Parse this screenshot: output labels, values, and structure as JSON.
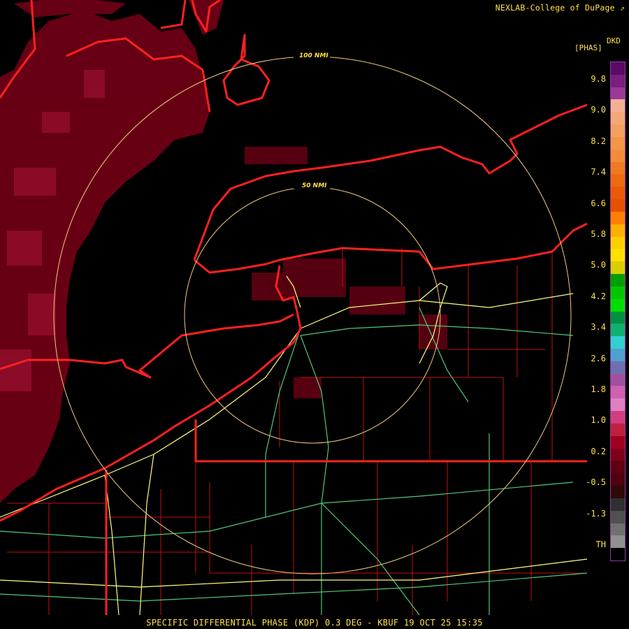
{
  "credit": "NEXLAB-College of DuPage",
  "credit_icon": "cursor-arrow-icon",
  "product_code": "DKD",
  "units": "[PHAS]",
  "footer": "SPECIFIC DIFFERENTIAL PHASE (KDP) 0.3 DEG - KBUF 19 OCT 25 15:35",
  "range_rings": {
    "inner": "50 NMI",
    "outer": "100 NMI"
  },
  "colorbar": {
    "ticks": [
      "9.8",
      "9.0",
      "8.2",
      "7.4",
      "6.6",
      "5.8",
      "5.0",
      "4.2",
      "3.4",
      "2.6",
      "1.8",
      "1.0",
      "0.2",
      "-0.5",
      "-1.3",
      "TH"
    ],
    "colors": [
      "#5a0a66",
      "#7a1e80",
      "#9a3a96",
      "#f4b096",
      "#f5a877",
      "#f4a060",
      "#f39648",
      "#f38c3a",
      "#f07a20",
      "#ee6a10",
      "#ea5a08",
      "#e85000",
      "#ff8000",
      "#ffb000",
      "#ffd000",
      "#ffe000",
      "#d8d000",
      "#00a000",
      "#00c800",
      "#00e000",
      "#009040",
      "#10b070",
      "#30d0d0",
      "#50a0d0",
      "#7070b0",
      "#a050a0",
      "#d060b0",
      "#e080c0",
      "#d04080",
      "#c02040",
      "#a00020",
      "#800018",
      "#600010",
      "#500010",
      "#300808",
      "#303030",
      "#505050",
      "#707070",
      "#909090",
      "#000000"
    ]
  },
  "colors": {
    "echo": "#7a0018",
    "border_state": "#ff2020",
    "border_county": "#c01010",
    "highway": "#ffff80",
    "road": "#50c878",
    "ring": "#f0c880",
    "text": "#ffe04a"
  }
}
